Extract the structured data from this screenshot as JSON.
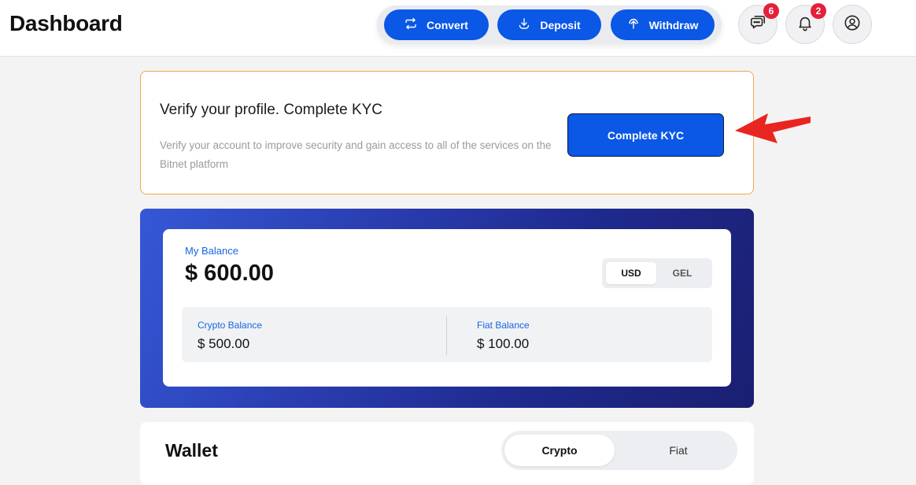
{
  "header": {
    "title": "Dashboard",
    "actions": {
      "convert": "Convert",
      "deposit": "Deposit",
      "withdraw": "Withdraw"
    },
    "messages_badge": "6",
    "notifications_badge": "2",
    "icons": [
      "chat-icon",
      "bell-icon",
      "user-icon"
    ]
  },
  "kyc": {
    "title": "Verify your profile. Complete KYC",
    "description": "Verify your account to improve security and gain access to all of the services on the Bitnet platform",
    "button_label": "Complete KYC"
  },
  "balance": {
    "label": "My Balance",
    "amount": "$ 600.00",
    "currencies": [
      "USD",
      "GEL"
    ],
    "selected_currency": "USD",
    "crypto_label": "Crypto Balance",
    "crypto_value": "$ 500.00",
    "fiat_label": "Fiat Balance",
    "fiat_value": "$ 100.00"
  },
  "wallet": {
    "title": "Wallet",
    "tabs": [
      "Crypto",
      "Fiat"
    ],
    "selected_tab": "Crypto"
  },
  "colors": {
    "primary": "#0b57e6",
    "kyc_border": "#f0a948",
    "badge": "#e5203a",
    "label_blue": "#1766e0",
    "annotation_arrow": "#e8261f"
  }
}
